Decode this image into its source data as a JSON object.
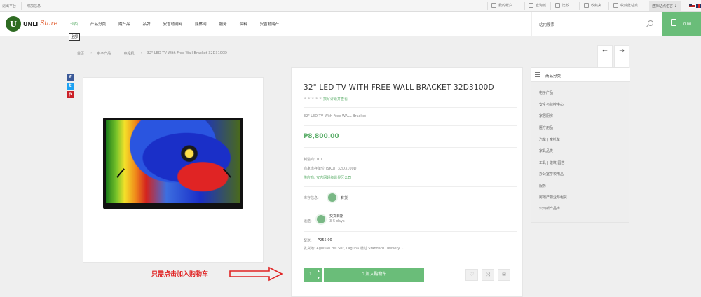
{
  "topbar": {
    "left_items": [
      "退出平台",
      "附加信息"
    ],
    "right_items": [
      "我的帐户",
      "查询城",
      "比较",
      "收藏夹",
      "收藏此站点"
    ],
    "language": "选择站点语言"
  },
  "header": {
    "logo_text": "UNLI",
    "logo_script": "Store",
    "nav": [
      "卡西",
      "产品分类",
      "购产品",
      "品牌",
      "安吉勒测网",
      "媒体网",
      "服务",
      "资料",
      "安吉勒购产"
    ],
    "all_button": "全部",
    "search_placeholder": "站内搜索",
    "cart_amount": "0.00"
  },
  "breadcrumb": [
    "首页",
    "电子产品",
    "电视机",
    "32\" LED TV With Free Wall Bracket 32D3100D"
  ],
  "nav_arrows": {
    "prev": "←",
    "next": "→"
  },
  "social": {
    "facebook": "f",
    "twitter": "t",
    "pinterest": "p"
  },
  "product": {
    "title": "32\" LED TV WITH FREE WALL BRACKET 32D3100D",
    "stars": "★★★★★",
    "review_link": "撰写评论并查看",
    "subtitle": "32\" LED TV With Free WALL Bracket",
    "price": "₱8,800.00",
    "brand_line": "制造商: TCL",
    "sku_line": "商家库存单位 (SKU): 32D3100D",
    "seller_line": "供应商: 安吉网超级世界区公司",
    "stock_label": "库存信息:",
    "stock_value": "有货",
    "delivery_label": "运送:",
    "delivery_title": "交货日期",
    "delivery_days": "3-5 days",
    "shipping_label": "配送:",
    "shipping_price": "₱255.00",
    "shipping_detail": "发货地: Aguisan del Sur, Laguna 通过 Standard Delivery ⌄",
    "qty": "1",
    "add_to_cart": "加入购物车"
  },
  "categories": {
    "header": "商品分类",
    "items": [
      "电子产品",
      "安全与监控中心",
      "家居厨房",
      "医疗用品",
      "汽车 | 摩托车",
      "家具品类",
      "工具 | 建筑 园艺",
      "办公室学校用品",
      "服务",
      "房地产物业与租赁",
      "公司新产品库"
    ]
  },
  "annotation": "只需点击加入购物车",
  "colors": {
    "accent": "#6abd79",
    "annotation": "#e02424"
  }
}
